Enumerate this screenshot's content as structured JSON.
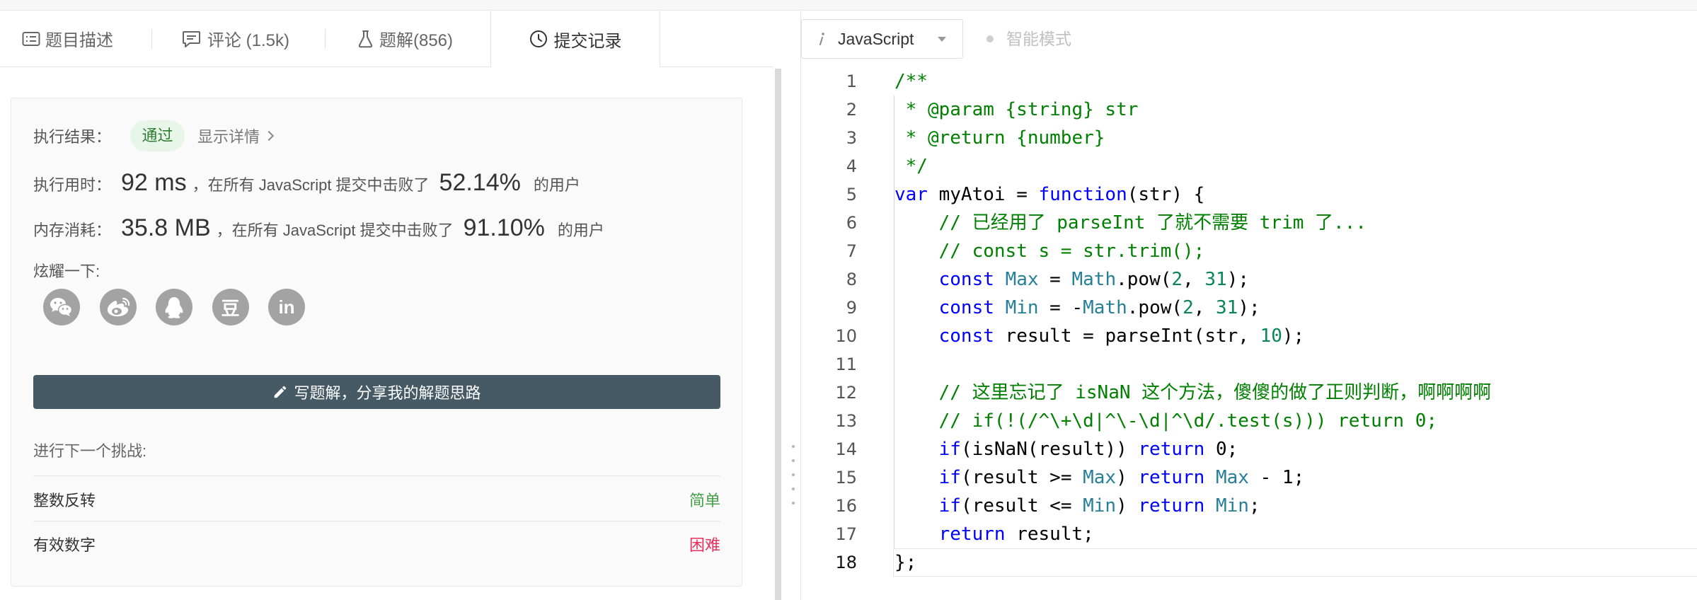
{
  "tabs": [
    {
      "label": "题目描述",
      "icon": "description-icon"
    },
    {
      "label": "评论 (1.5k)",
      "icon": "comment-icon"
    },
    {
      "label": "题解(856)",
      "icon": "flask-icon"
    },
    {
      "label": "提交记录",
      "icon": "clock-icon",
      "active": true
    }
  ],
  "editor_header": {
    "language": "JavaScript",
    "language_icon": "info-icon",
    "smart_mode": "智能模式"
  },
  "result": {
    "label": "执行结果：",
    "status": "通过",
    "details_link": "显示详情"
  },
  "runtime": {
    "label": "执行用时：",
    "value": "92 ms",
    "middle": "，在所有 JavaScript 提交中击败了",
    "percent": "52.14%",
    "suffix": "的用户"
  },
  "memory": {
    "label": "内存消耗：",
    "value": "35.8 MB",
    "middle": "，在所有 JavaScript 提交中击败了",
    "percent": "91.10%",
    "suffix": "的用户"
  },
  "share": {
    "label": "炫耀一下:",
    "icons": [
      {
        "name": "wechat-icon"
      },
      {
        "name": "weibo-icon"
      },
      {
        "name": "qq-icon"
      },
      {
        "name": "douban-icon",
        "glyph": "豆"
      },
      {
        "name": "linkedin-icon",
        "glyph": "in"
      }
    ]
  },
  "write_solution_button": "写题解，分享我的解题思路",
  "next_challenge": {
    "label": "进行下一个挑战:",
    "items": [
      {
        "title": "整数反转",
        "difficulty": "简单",
        "color": "#43a047"
      },
      {
        "title": "有效数字",
        "difficulty": "困难",
        "color": "#e8305e"
      }
    ]
  },
  "colors": {
    "button": "#455a64",
    "pass_text": "#2e7d32",
    "pass_bg": "#e8f5e9"
  },
  "code": {
    "active_line": 18,
    "lines": [
      {
        "n": "1",
        "tokens": [
          [
            "/**",
            "#008000"
          ]
        ]
      },
      {
        "n": "2",
        "tokens": [
          [
            " * @param {string} str",
            "#008000"
          ]
        ]
      },
      {
        "n": "3",
        "tokens": [
          [
            " * @return {number}",
            "#008000"
          ]
        ]
      },
      {
        "n": "4",
        "tokens": [
          [
            " */",
            "#008000"
          ]
        ]
      },
      {
        "n": "5",
        "tokens": [
          [
            "var",
            "#0000ff"
          ],
          [
            " myAtoi = ",
            "#000000"
          ],
          [
            "function",
            "#0000ff"
          ],
          [
            "(str) {",
            "#000000"
          ]
        ]
      },
      {
        "n": "6",
        "tokens": [
          [
            "    ",
            "#000000"
          ],
          [
            "// 已经用了 parseInt 了就不需要 trim 了...",
            "#008000"
          ]
        ]
      },
      {
        "n": "7",
        "tokens": [
          [
            "    ",
            "#000000"
          ],
          [
            "// const s = str.trim();",
            "#008000"
          ]
        ]
      },
      {
        "n": "8",
        "tokens": [
          [
            "    ",
            "#000000"
          ],
          [
            "const",
            "#0000ff"
          ],
          [
            " ",
            "#000000"
          ],
          [
            "Max",
            "#267f99"
          ],
          [
            " = ",
            "#000000"
          ],
          [
            "Math",
            "#267f99"
          ],
          [
            ".pow(",
            "#000000"
          ],
          [
            "2",
            "#098658"
          ],
          [
            ", ",
            "#000000"
          ],
          [
            "31",
            "#098658"
          ],
          [
            ");",
            "#000000"
          ]
        ]
      },
      {
        "n": "9",
        "tokens": [
          [
            "    ",
            "#000000"
          ],
          [
            "const",
            "#0000ff"
          ],
          [
            " ",
            "#000000"
          ],
          [
            "Min",
            "#267f99"
          ],
          [
            " = -",
            "#000000"
          ],
          [
            "Math",
            "#267f99"
          ],
          [
            ".pow(",
            "#000000"
          ],
          [
            "2",
            "#098658"
          ],
          [
            ", ",
            "#000000"
          ],
          [
            "31",
            "#098658"
          ],
          [
            ");",
            "#000000"
          ]
        ]
      },
      {
        "n": "10",
        "tokens": [
          [
            "    ",
            "#000000"
          ],
          [
            "const",
            "#0000ff"
          ],
          [
            " result = parseInt(str, ",
            "#000000"
          ],
          [
            "10",
            "#098658"
          ],
          [
            ");",
            "#000000"
          ]
        ]
      },
      {
        "n": "11",
        "tokens": []
      },
      {
        "n": "12",
        "tokens": [
          [
            "    ",
            "#000000"
          ],
          [
            "// 这里忘记了 isNaN 这个方法，傻傻的做了正则判断，啊啊啊啊",
            "#008000"
          ]
        ]
      },
      {
        "n": "13",
        "tokens": [
          [
            "    ",
            "#000000"
          ],
          [
            "// if(!(/^\\+\\d|^\\-\\d|^\\d/.test(s))) return 0;",
            "#008000"
          ]
        ]
      },
      {
        "n": "14",
        "tokens": [
          [
            "    ",
            "#000000"
          ],
          [
            "if",
            "#0000ff"
          ],
          [
            "(isNaN(result)) ",
            "#000000"
          ],
          [
            "return",
            "#0000ff"
          ],
          [
            " 0;",
            "#000000"
          ]
        ]
      },
      {
        "n": "15",
        "tokens": [
          [
            "    ",
            "#000000"
          ],
          [
            "if",
            "#0000ff"
          ],
          [
            "(result >= ",
            "#000000"
          ],
          [
            "Max",
            "#267f99"
          ],
          [
            ") ",
            "#000000"
          ],
          [
            "return",
            "#0000ff"
          ],
          [
            " ",
            "#000000"
          ],
          [
            "Max",
            "#267f99"
          ],
          [
            " - 1;",
            "#000000"
          ]
        ]
      },
      {
        "n": "16",
        "tokens": [
          [
            "    ",
            "#000000"
          ],
          [
            "if",
            "#0000ff"
          ],
          [
            "(result <= ",
            "#000000"
          ],
          [
            "Min",
            "#267f99"
          ],
          [
            ") ",
            "#000000"
          ],
          [
            "return",
            "#0000ff"
          ],
          [
            " ",
            "#000000"
          ],
          [
            "Min",
            "#267f99"
          ],
          [
            ";",
            "#000000"
          ]
        ]
      },
      {
        "n": "17",
        "tokens": [
          [
            "    ",
            "#000000"
          ],
          [
            "return",
            "#0000ff"
          ],
          [
            " result;",
            "#000000"
          ]
        ]
      },
      {
        "n": "18",
        "tokens": [
          [
            "};",
            "#000000"
          ]
        ]
      }
    ]
  }
}
